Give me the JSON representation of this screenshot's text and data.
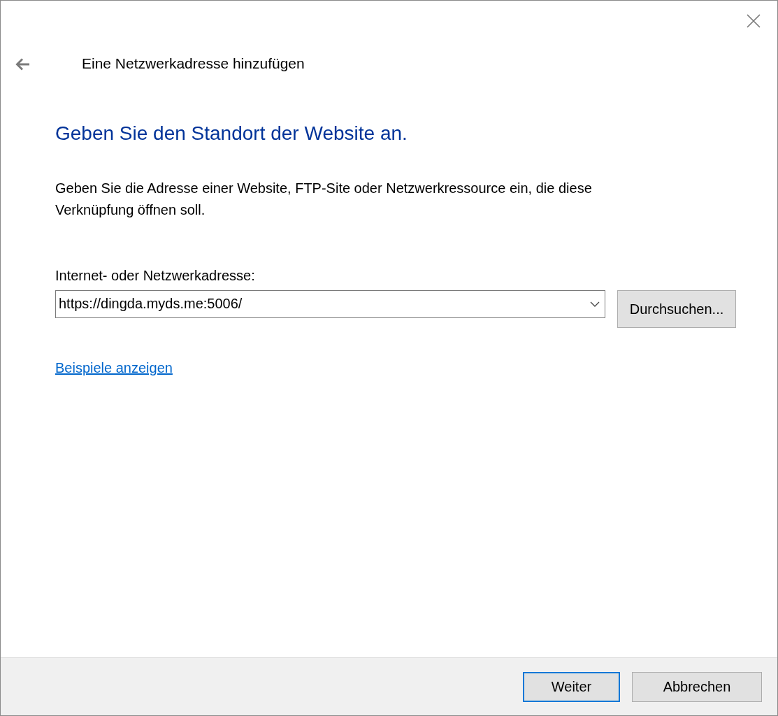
{
  "window": {
    "title": "Eine Netzwerkadresse hinzufügen"
  },
  "heading": "Geben Sie den Standort der Website an.",
  "description": "Geben Sie die Adresse einer Website, FTP-Site oder Netzwerkressource ein, die diese Verknüpfung öffnen soll.",
  "address": {
    "label": "Internet- oder Netzwerkadresse:",
    "value": "https://dingda.myds.me:5006/",
    "browse_button": "Durchsuchen..."
  },
  "examples_link": "Beispiele anzeigen",
  "buttons": [
    {
      "label": "Weiter",
      "default": true
    },
    {
      "label": "Abbrechen",
      "default": false
    }
  ]
}
